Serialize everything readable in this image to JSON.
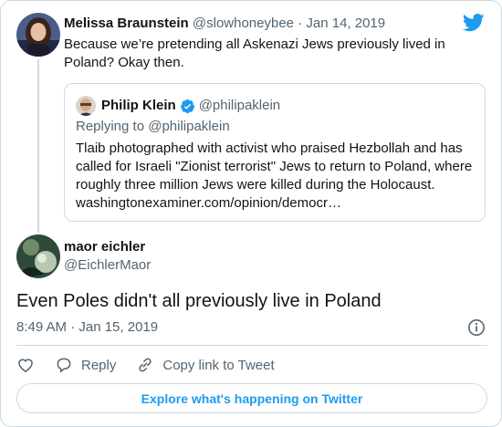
{
  "colors": {
    "accent": "#1d9bf0",
    "muted": "#536471",
    "border": "#cfd9de",
    "text": "#0f1419"
  },
  "icons": {
    "brand": "twitter-bird-icon",
    "verified": "verified-badge-icon",
    "info": "info-icon",
    "like": "heart-icon",
    "reply": "reply-bubble-icon",
    "copy": "link-icon"
  },
  "parent": {
    "name": "Melissa Braunstein",
    "handle": "@slowhoneybee",
    "separator": "·",
    "date": "Jan 14, 2019",
    "text": "Because we’re pretending all Askenazi Jews previously lived in Poland? Okay then."
  },
  "quoted": {
    "name": "Philip Klein",
    "handle": "@philipaklein",
    "replying_to": "Replying to @philipaklein",
    "text": "Tlaib photographed with activist who praised Hezbollah and has called for Israeli \"Zionist terrorist\" Jews to return to Poland, where roughly three million Jews were killed during the Holocaust.",
    "link": "washingtonexaminer.com/opinion/democr…"
  },
  "main": {
    "name": "maor eichler",
    "handle": "@EichlerMaor",
    "text": "Even Poles didn't all previously live in Poland",
    "timestamp": "8:49 AM · Jan 15, 2019"
  },
  "actions": {
    "reply_label": "Reply",
    "copy_label": "Copy link to Tweet"
  },
  "explore_label": "Explore what's happening on Twitter"
}
